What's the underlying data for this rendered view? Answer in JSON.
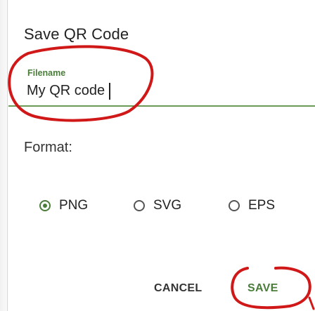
{
  "dialog": {
    "title": "Save QR Code",
    "filename_label": "Filename",
    "filename_value": "My QR code",
    "format_label": "Format:",
    "formats": [
      {
        "label": "PNG",
        "selected": true
      },
      {
        "label": "SVG",
        "selected": false
      },
      {
        "label": "EPS",
        "selected": false
      }
    ],
    "cancel_label": "CANCEL",
    "save_label": "SAVE"
  },
  "colors": {
    "accent": "#4a7d3a",
    "annotation": "#d01818"
  }
}
